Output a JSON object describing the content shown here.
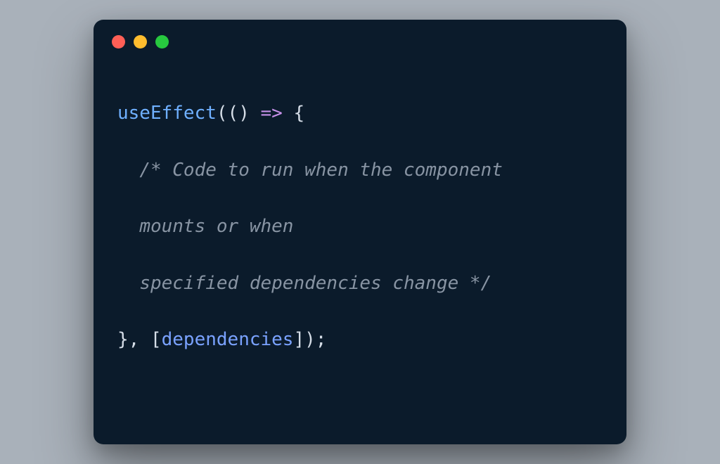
{
  "traffic_lights": {
    "red": "#ff5f56",
    "yellow": "#ffbd2e",
    "green": "#27c93f"
  },
  "code": {
    "fn": "useEffect",
    "open_paren": "(",
    "arrow_args": "()",
    "arrow": " => ",
    "open_brace": "{",
    "comment_line1": "/* Code to run when the component",
    "comment_line2": "mounts or when",
    "comment_line3": "specified dependencies change */",
    "close_brace": "}",
    "comma_space": ", ",
    "open_bracket": "[",
    "dep_ident": "dependencies",
    "close_bracket": "]",
    "close_paren_semi": ");"
  }
}
